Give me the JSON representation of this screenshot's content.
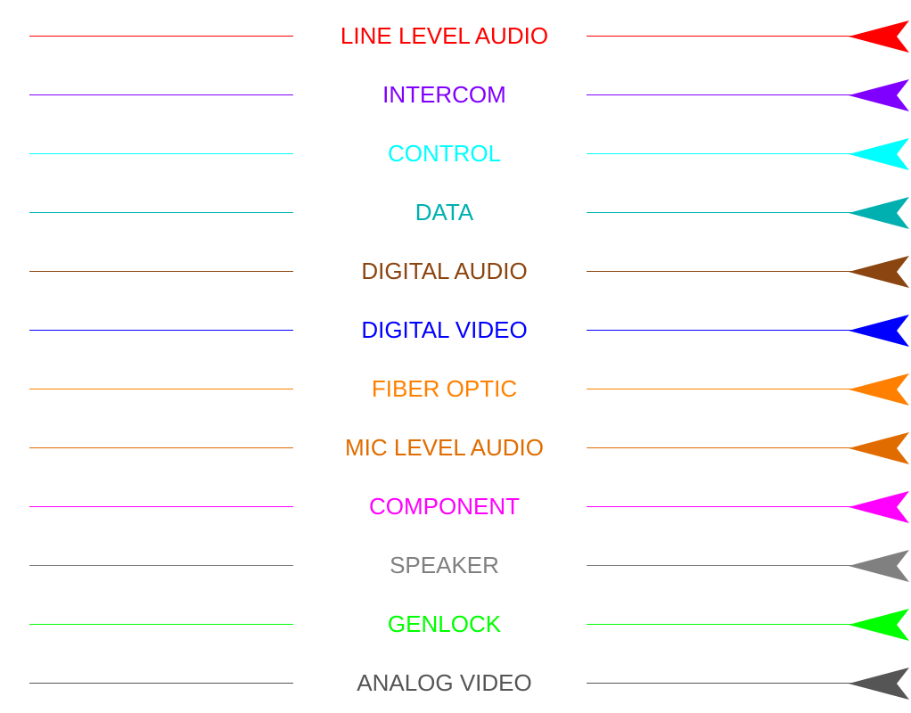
{
  "legend": {
    "items": [
      {
        "label": "LINE LEVEL AUDIO",
        "color": "#ff0000"
      },
      {
        "label": "INTERCOM",
        "color": "#8000ff"
      },
      {
        "label": "CONTROL",
        "color": "#00ffff"
      },
      {
        "label": "DATA",
        "color": "#00b0b0"
      },
      {
        "label": "DIGITAL AUDIO",
        "color": "#8b4510"
      },
      {
        "label": "DIGITAL VIDEO",
        "color": "#0000ff"
      },
      {
        "label": "FIBER OPTIC",
        "color": "#ff8000"
      },
      {
        "label": "MIC LEVEL AUDIO",
        "color": "#e06c00"
      },
      {
        "label": "COMPONENT",
        "color": "#ff00ff"
      },
      {
        "label": "SPEAKER",
        "color": "#808080"
      },
      {
        "label": "GENLOCK",
        "color": "#00ff00"
      },
      {
        "label": "ANALOG VIDEO",
        "color": "#555555"
      }
    ],
    "arrow_icon": "arrowhead-left-icon"
  }
}
